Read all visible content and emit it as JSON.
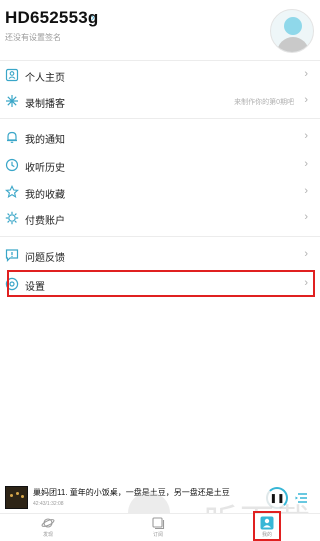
{
  "profile": {
    "username": "HD652553g",
    "chevron": "›",
    "signature": "还没有设置签名"
  },
  "menu": {
    "group1": [
      {
        "label": "个人主页",
        "icon": "user-card-icon"
      },
      {
        "label": "录制播客",
        "icon": "record-star-icon",
        "hint": "来制作你的第0期吧"
      }
    ],
    "group2": [
      {
        "label": "我的通知",
        "icon": "bell-icon"
      },
      {
        "label": "收听历史",
        "icon": "clock-icon"
      },
      {
        "label": "我的收藏",
        "icon": "star-icon"
      },
      {
        "label": "付费账户",
        "icon": "gear-account-icon"
      }
    ],
    "group3": [
      {
        "label": "问题反馈",
        "icon": "feedback-icon"
      },
      {
        "label": "设置",
        "icon": "settings-icon"
      }
    ],
    "chevron": "›"
  },
  "player": {
    "title": "巢妈团11. 童年的小饭桌，一盘是土豆，另一盘还是土豆",
    "time": "42:43/1:32:08",
    "pause_glyph": "❚❚"
  },
  "tabbar": {
    "tabs": [
      {
        "label": "发现",
        "icon": "planet-icon"
      },
      {
        "label": "订阅",
        "icon": "subscribe-icon"
      },
      {
        "label": "我的",
        "icon": "profile-icon",
        "active": true
      }
    ]
  },
  "watermark": "一听下载",
  "colors": {
    "accent": "#37b6d6",
    "highlight": "#e02020",
    "icon": "#3aa6c8"
  }
}
